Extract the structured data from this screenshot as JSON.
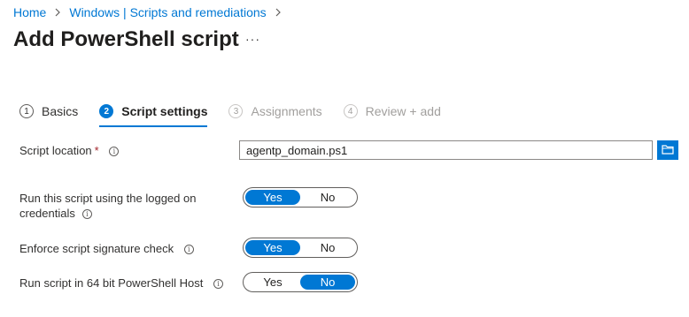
{
  "breadcrumb": {
    "home": "Home",
    "section": "Windows | Scripts and remediations"
  },
  "page": {
    "title": "Add PowerShell script",
    "more": "···"
  },
  "steps": [
    {
      "num": "1",
      "label": "Basics",
      "state": "done"
    },
    {
      "num": "2",
      "label": "Script settings",
      "state": "active"
    },
    {
      "num": "3",
      "label": "Assignments",
      "state": "disabled"
    },
    {
      "num": "4",
      "label": "Review + add",
      "state": "disabled"
    }
  ],
  "form": {
    "script_location": {
      "label": "Script location",
      "required_mark": "*",
      "value": "agentp_domain.ps1"
    },
    "run_logged_on": {
      "label_line1": "Run this script using the logged on",
      "label_line2": "credentials",
      "yes": "Yes",
      "no": "No",
      "selected": "Yes"
    },
    "enforce_signature": {
      "label": "Enforce script signature check",
      "yes": "Yes",
      "no": "No",
      "selected": "Yes"
    },
    "run_64bit": {
      "label": "Run script in 64 bit PowerShell Host",
      "yes": "Yes",
      "no": "No",
      "selected": "No"
    }
  },
  "icons": {
    "chevron": "chevron-right-icon",
    "info": "info-icon",
    "folder": "folder-icon"
  },
  "colors": {
    "accent": "#0078d4",
    "required": "#a4262c"
  }
}
